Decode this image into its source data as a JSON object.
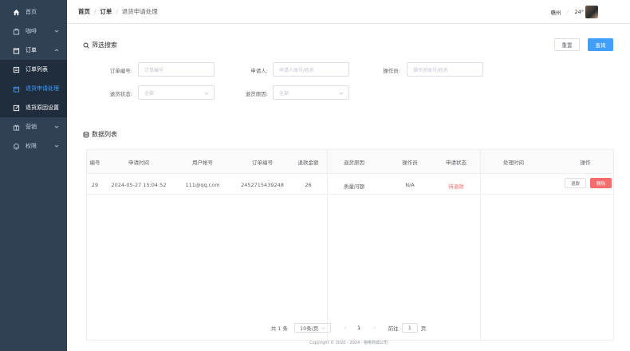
{
  "sidebar": {
    "items": [
      {
        "label": "首页",
        "icon": "home-icon"
      },
      {
        "label": "咖啡",
        "icon": "bag-icon"
      },
      {
        "label": "订单",
        "icon": "order-icon"
      },
      {
        "label": "订单列表",
        "icon": "list-icon"
      },
      {
        "label": "退货申请处理",
        "icon": "box-icon"
      },
      {
        "label": "退货原因设置",
        "icon": "edit-icon"
      },
      {
        "label": "营销",
        "icon": "gift-icon"
      },
      {
        "label": "权限",
        "icon": "bell-icon"
      }
    ]
  },
  "header": {
    "crumbs": [
      "首页",
      "订单",
      "退货申请处理"
    ],
    "city": "赣州",
    "temperature": "24°"
  },
  "filter": {
    "title": "筛选搜索",
    "reset_label": "重置",
    "query_label": "查询",
    "order_no_label": "订单编号:",
    "order_no_placeholder": "订单编号",
    "applicant_label": "申请人:",
    "applicant_placeholder": "申请人账号/姓名",
    "operator_label": "操作员:",
    "operator_placeholder": "操作员账号/姓名",
    "status_label": "退货状态:",
    "status_value": "全部",
    "reason_label": "退货原因:",
    "reason_value": "全部"
  },
  "list": {
    "title": "数据列表",
    "columns": [
      "编号",
      "申请时间",
      "用户帐号",
      "订单编号",
      "退款金额",
      "退货原因",
      "操作员",
      "申请状态",
      "处理时间",
      "操作"
    ],
    "rows": [
      {
        "id": "29",
        "time": "2024-05-27 15:04:52",
        "account": "111@qq.com",
        "order_no": "2452715439248",
        "amount": "26",
        "reason": "质量问题",
        "operator": "N/A",
        "status": "待退款",
        "handled_time": "",
        "refund_label": "退款",
        "delete_label": "删除"
      }
    ]
  },
  "pager": {
    "total": "共 1 条",
    "page_size": "10条/页",
    "prev": "‹",
    "current": "1",
    "next": "›",
    "goto_label": "前往",
    "goto_value": "1",
    "page_suffix": "页"
  },
  "footer": {
    "copyright": "Copyright © 2020 - 2024 · 咖啡商城公司"
  },
  "colors": {
    "sidebar": "#304156",
    "accent": "#409eff",
    "danger": "#f56c6c",
    "status_red": "#f56c6c"
  }
}
